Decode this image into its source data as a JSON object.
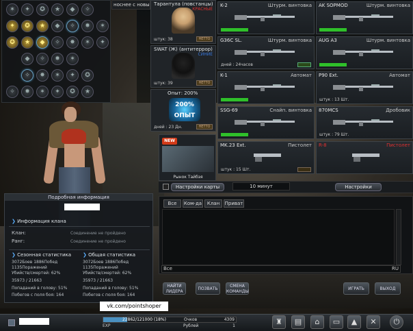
{
  "news_ticker": "носнее с новым",
  "characters": [
    {
      "name": "Тарантула (повстанцы)",
      "type": "КРАСНЫЕ",
      "type_color": "#e03030",
      "count_label": "штук:",
      "count": "38",
      "price": "НЕТТО"
    },
    {
      "name": "SWAT (Ж) (антитеррор)",
      "type": "СИНИЕ",
      "type_color": "#3a7ae0",
      "count_label": "штук:",
      "count": "39",
      "price": "НЕТТО"
    }
  ],
  "xp_card": {
    "title": "Опыт: 200%",
    "badge_top": "200%",
    "badge_bottom": "ОПЫТ",
    "days": "дней : 23 Дн.",
    "price": "НЕТТО"
  },
  "weapons": [
    {
      "name": "K-2",
      "type": "Штурм. винтовка",
      "bar": true,
      "name_red": false
    },
    {
      "name": "AK SOPMOD",
      "type": "Штурм. винтовка",
      "bar": true,
      "name_red": false
    },
    {
      "name": "G36C SL.",
      "type": "Штурм. винтовка",
      "amount": "дней : 24часов",
      "mini": "green",
      "name_red": false
    },
    {
      "name": "AUG A3",
      "type": "Штурм. винтовка",
      "bar": true,
      "name_red": false
    },
    {
      "name": "K-1",
      "type": "Автомат",
      "bar": true,
      "name_red": false
    },
    {
      "name": "P90 Ext.",
      "type": "Автомат",
      "amount": "штук : 13 Шт.",
      "name_red": false
    },
    {
      "name": "SSG-69",
      "type": "Снайп. винтовка",
      "bar": true,
      "name_red": false
    },
    {
      "name": "870MCS",
      "type": "Дробовик",
      "amount": "штук : 79 Шт.",
      "name_red": false
    },
    {
      "name": "MK.23 Ext.",
      "type": "Пистолет",
      "amount": "штук : 15 Шт.",
      "mini": "gold",
      "name_red": false
    },
    {
      "name": "R-8",
      "type": "Пистолет",
      "bar": false,
      "name_red": true
    }
  ],
  "market": {
    "new_label": "NEW",
    "title": "Рынок Тайбэя"
  },
  "room": {
    "map_settings": "Настройки карты",
    "timer": "10 минут",
    "settings": "Настройки"
  },
  "info": {
    "header": "Подробная информация",
    "clan_info": "Информация клана",
    "clan_label": "Клан:",
    "rank_label": "Ранг:",
    "not_connected": "Соединение не пройдено",
    "season_stats": "Сезонная статистика",
    "total_stats": "Общая статистика",
    "season": {
      "games": "3072Боев 1886Побед",
      "losses": "1135Поражений",
      "kd": "Убийств/смертей: 62%",
      "kills": "35973 / 21663",
      "headshots": "Попаданий в голову: 51%",
      "wins": "Побегов с поля боя: 164"
    },
    "total": {
      "games": "3072Боев 1886Побед",
      "losses": "1135Поражений",
      "kd": "Убийств/смертей: 62%",
      "kills": "35973 / 21663",
      "headshots": "Попаданий в голову: 51%",
      "wins": "Побегов с поля боя: 164"
    }
  },
  "chat": {
    "tabs": [
      "Все",
      "Ком-да",
      "Клан",
      "Приват"
    ],
    "input_prefix": "Все",
    "input_suffix": "RU"
  },
  "buttons": {
    "find_leader": "НАЙТИ ЛИДЕРА",
    "invite": "ПОЗВАТЬ",
    "change_team": "СМЕНА КОМАНДЫ",
    "play": "ИГРАТЬ",
    "exit": "ВЫХОД"
  },
  "watermark": "vk.com/pointshoper",
  "bottom": {
    "xp": "22862/121000 (18%)",
    "points_label": "Очков",
    "points": "4309",
    "rubles_label": "Рублей",
    "rubles": "1",
    "exp_label": "EXP"
  }
}
